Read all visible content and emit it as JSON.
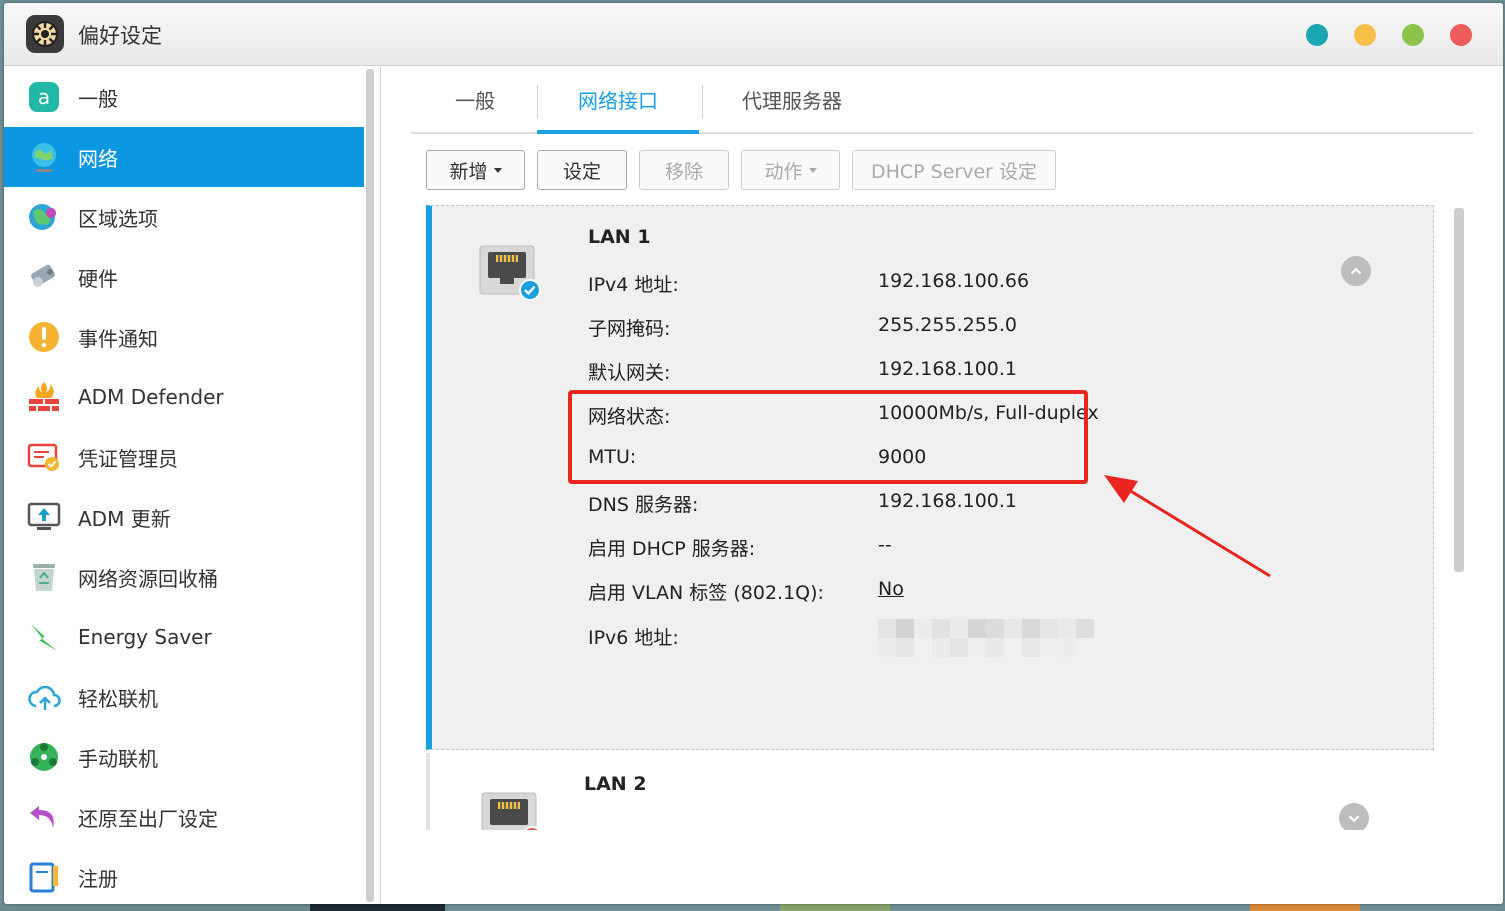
{
  "window": {
    "title": "偏好设定"
  },
  "colors": {
    "accent": "#0b97e1",
    "tab_active": "#1aa0e0",
    "highlight": "#e8261f",
    "win_teal": "#1aa7b3",
    "win_yellow": "#f5c04a",
    "win_green": "#8cc34a",
    "win_red": "#ef5b5b"
  },
  "sidebar": {
    "items": [
      {
        "label": "一般",
        "icon": "general-icon"
      },
      {
        "label": "网络",
        "icon": "network-globe-icon"
      },
      {
        "label": "区域选项",
        "icon": "region-globe-icon"
      },
      {
        "label": "硬件",
        "icon": "hardware-icon"
      },
      {
        "label": "事件通知",
        "icon": "alert-icon"
      },
      {
        "label": "ADM Defender",
        "icon": "firewall-icon"
      },
      {
        "label": "凭证管理员",
        "icon": "certificate-icon"
      },
      {
        "label": "ADM 更新",
        "icon": "update-icon"
      },
      {
        "label": "网络资源回收桶",
        "icon": "recycle-bin-icon"
      },
      {
        "label": "Energy Saver",
        "icon": "energy-icon"
      },
      {
        "label": "轻松联机",
        "icon": "cloud-icon"
      },
      {
        "label": "手动联机",
        "icon": "connect-icon"
      },
      {
        "label": "还原至出厂设定",
        "icon": "restore-icon"
      },
      {
        "label": "注册",
        "icon": "register-icon"
      }
    ]
  },
  "tabs": [
    {
      "label": "一般"
    },
    {
      "label": "网络接口"
    },
    {
      "label": "代理服务器"
    }
  ],
  "toolbar": {
    "add_label": "新增",
    "settings_label": "设定",
    "remove_label": "移除",
    "action_label": "动作",
    "dhcp_label": "DHCP Server 设定"
  },
  "lan1": {
    "title": "LAN 1",
    "rows": [
      {
        "label": "IPv4 地址:",
        "value": "192.168.100.66"
      },
      {
        "label": "子网掩码:",
        "value": "255.255.255.0"
      },
      {
        "label": "默认网关:",
        "value": "192.168.100.1"
      },
      {
        "label": "网络状态:",
        "value": "10000Mb/s, Full-duplex"
      },
      {
        "label": "MTU:",
        "value": "9000"
      },
      {
        "label": "DNS 服务器:",
        "value": "192.168.100.1"
      },
      {
        "label": "启用 DHCP 服务器:",
        "value": "--"
      },
      {
        "label": "启用 VLAN 标签 (802.1Q):",
        "value": "No"
      },
      {
        "label": "IPv6 地址:",
        "value": ""
      }
    ]
  },
  "lan2": {
    "title": "LAN 2"
  }
}
